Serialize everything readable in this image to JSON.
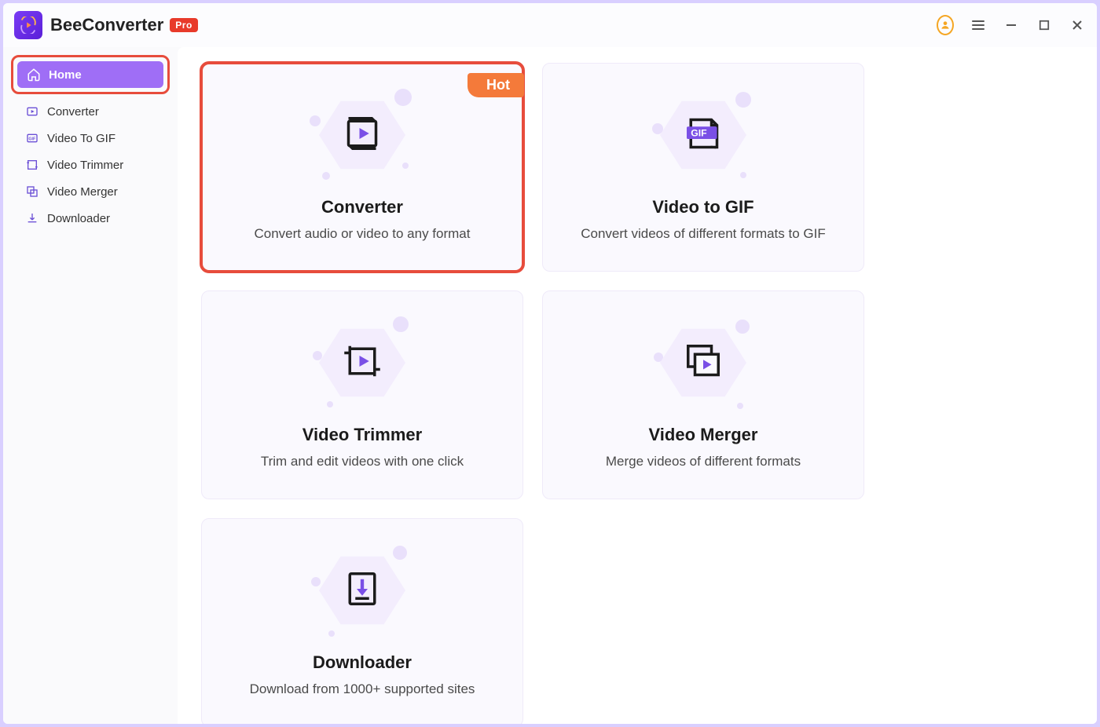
{
  "app": {
    "name": "BeeConverter",
    "badge": "Pro"
  },
  "sidebar": {
    "items": [
      {
        "label": "Home",
        "icon": "home-icon",
        "active": true
      },
      {
        "label": "Converter",
        "icon": "converter-icon",
        "active": false
      },
      {
        "label": "Video To GIF",
        "icon": "gif-icon",
        "active": false
      },
      {
        "label": "Video Trimmer",
        "icon": "trimmer-icon",
        "active": false
      },
      {
        "label": "Video Merger",
        "icon": "merger-icon",
        "active": false
      },
      {
        "label": "Downloader",
        "icon": "downloader-icon",
        "active": false
      }
    ]
  },
  "cards": [
    {
      "title": "Converter",
      "desc": "Convert audio or video to any format",
      "badge": "Hot",
      "highlight": true,
      "icon": "converter"
    },
    {
      "title": "Video to GIF",
      "desc": "Convert videos of different formats to GIF",
      "icon": "gif"
    },
    {
      "title": "Video Trimmer",
      "desc": "Trim and edit videos with one click",
      "icon": "trimmer"
    },
    {
      "title": "Video Merger",
      "desc": "Merge videos of different formats",
      "icon": "merger"
    },
    {
      "title": "Downloader",
      "desc": "Download from 1000+ supported sites",
      "icon": "downloader"
    }
  ],
  "colors": {
    "accent": "#9f6ef6",
    "highlight": "#e74c3c",
    "hot": "#f47a3a"
  }
}
